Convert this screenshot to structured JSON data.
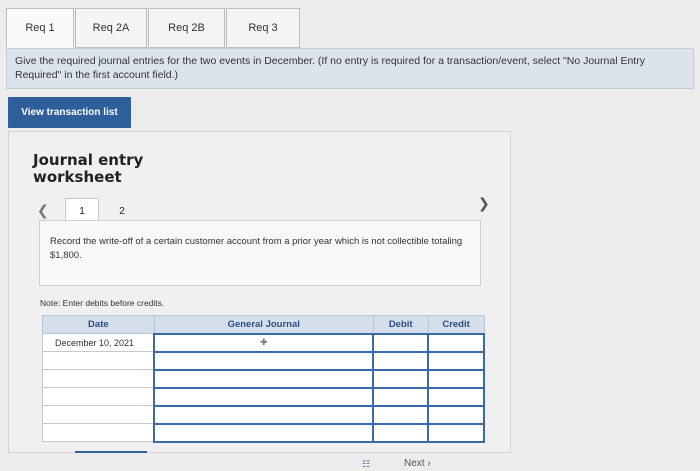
{
  "tabs": [
    {
      "label": "Req 1"
    },
    {
      "label": "Req 2A"
    },
    {
      "label": "Req 2B"
    },
    {
      "label": "Req 3"
    }
  ],
  "instructions": "Give the required journal entries for the two events in December. (If no entry is required for a transaction/event, select \"No Journal Entry Required\" in the first account field.)",
  "view_button_label": "View transaction list",
  "worksheet": {
    "title": "Journal entry worksheet",
    "pages": [
      "1",
      "2"
    ],
    "prompt": "Record the write-off of a certain customer account from a prior year which is not collectible totaling $1,800.",
    "note": "Note: Enter debits before credits.",
    "table": {
      "headers": {
        "date": "Date",
        "account": "General Journal",
        "debit": "Debit",
        "credit": "Credit"
      },
      "first_date": "December 10, 2021"
    }
  },
  "footer": {
    "next": "Next"
  }
}
